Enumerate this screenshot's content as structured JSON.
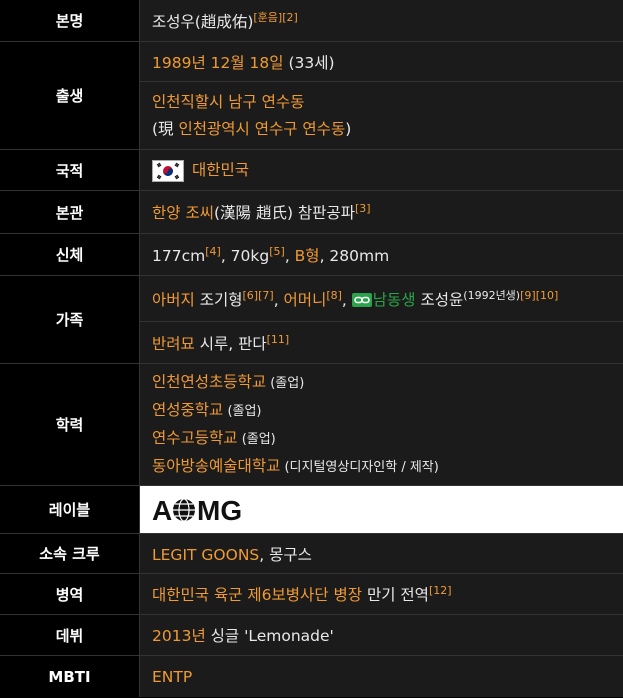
{
  "rows": {
    "name": {
      "label": "본명",
      "text": "조성우(趙成佑)",
      "ref1": "[훈음]",
      "ref2": "[2]"
    },
    "birth": {
      "label": "출생",
      "date": "1989년 12월 18일",
      "age": " (33세)",
      "place": "인천직할시 남구 연수동",
      "now_prefix": "(現 ",
      "now_place": "인천광역시 연수구 연수동",
      "now_suffix": ")"
    },
    "nationality": {
      "label": "국적",
      "country": "대한민국"
    },
    "origin": {
      "label": "본관",
      "place": "한양 조씨",
      "hanja": "(漢陽 趙氏) 참판공파",
      "ref": "[3]"
    },
    "body": {
      "label": "신체",
      "height": "177cm",
      "ref1": "[4]",
      "weight": ", 70kg",
      "ref2": "[5]",
      "comma": ", ",
      "blood": "B형",
      "foot": ", 280mm"
    },
    "family": {
      "label": "가족",
      "father": "아버지",
      "father_name": " 조기형",
      "ref1": "[6]",
      "ref2": "[7]",
      "comma1": ", ",
      "mother": "어머니",
      "ref3": "[8]",
      "comma2": ", ",
      "brother": "남동생",
      "brother_name": " 조성윤",
      "birth_note": "(1992년생)",
      "ref4": "[9]",
      "ref5": "[10]",
      "pet": "반려묘",
      "pet_names": " 시루, 판다",
      "ref6": "[11]"
    },
    "education": {
      "label": "학력",
      "s1": "인천연성초등학교",
      "s1n": " (졸업)",
      "s2": "연성중학교",
      "s2n": " (졸업)",
      "s3": "연수고등학교",
      "s3n": " (졸업)",
      "s4": "동아방송예술대학교",
      "s4n": " (디지털영상디자인학 / 제작)"
    },
    "label_company": {
      "label": "레이블",
      "logo": "AOMG"
    },
    "crew": {
      "label": "소속 크루",
      "crew": "LEGIT GOONS",
      "other": ", 몽구스"
    },
    "military": {
      "label": "병역",
      "unit": "대한민국 육군 제6보병사단 병장",
      "status": " 만기 전역",
      "ref": "[12]"
    },
    "debut": {
      "label": "데뷔",
      "year": "2013년",
      "single": " 싱글 'Lemonade'"
    },
    "mbti": {
      "label": "MBTI",
      "type": "ENTP"
    }
  }
}
